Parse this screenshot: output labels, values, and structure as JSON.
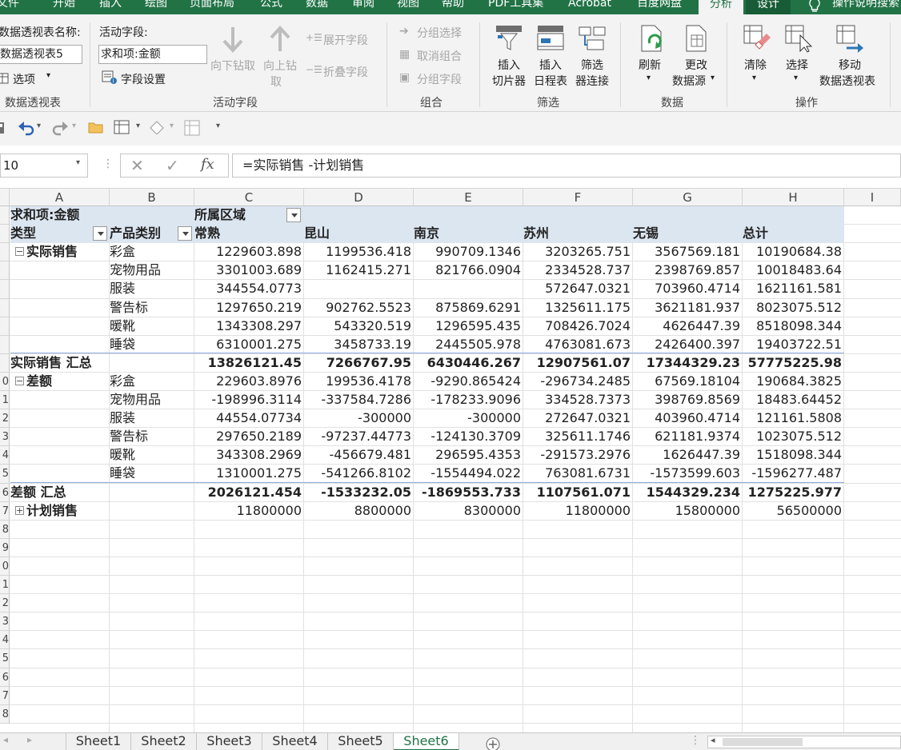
{
  "ribbon_tabs": [
    "文件",
    "开始",
    "插入",
    "绘图",
    "页面布局",
    "公式",
    "数据",
    "审阅",
    "视图",
    "帮助",
    "PDF工具集",
    "Acrobat",
    "百度网盘",
    "分析",
    "设计",
    "操作说明搜索"
  ],
  "pivot_group": {
    "name_label": "数据透视表名称:",
    "name_value": "数据透视表5",
    "options": "选项",
    "group_label": "数据透视表"
  },
  "active_field": {
    "label": "活动字段:",
    "value": "求和项:金额",
    "field_settings": "字段设置",
    "drill_down": "向下钻取",
    "drill_up_1": "向上钻",
    "drill_up_2": "取",
    "expand": "展开字段",
    "collapse": "折叠字段",
    "group_label": "活动字段"
  },
  "group": {
    "group_selection": "分组选择",
    "ungroup": "取消组合",
    "group_field": "分组字段",
    "group_label": "组合"
  },
  "filter": {
    "slicer_1": "插入",
    "slicer_2": "切片器",
    "timeline_1": "插入",
    "timeline_2": "日程表",
    "connections_1": "筛选",
    "connections_2": "器连接",
    "group_label": "筛选"
  },
  "data_group": {
    "refresh": "刷新",
    "change_1": "更改",
    "change_2": "数据源",
    "group_label": "数据"
  },
  "actions": {
    "clear": "清除",
    "select": "选择",
    "move_1": "移动",
    "move_2": "数据透视表",
    "group_label": "操作"
  },
  "formula_bar": {
    "name_box": "10",
    "fx": "fx",
    "formula": "=实际销售 -计划销售"
  },
  "columns": [
    "A",
    "B",
    "C",
    "D",
    "E",
    "F",
    "G",
    "H",
    "I"
  ],
  "row_numbers": [
    "",
    "",
    "",
    "",
    "",
    "",
    "",
    "",
    "",
    "0",
    "1",
    "2",
    "3",
    "4",
    "5",
    "6",
    "7",
    "8",
    "9",
    "0",
    "1",
    "2",
    "3",
    "4",
    "5",
    "6",
    "7",
    "8",
    "9"
  ],
  "pivot": {
    "value_label": "求和项:金额",
    "col_field": "所属区域",
    "row_field_1": "类型",
    "row_field_2": "产品类别",
    "regions": [
      "常熟",
      "昆山",
      "南京",
      "苏州",
      "无锡",
      "总计"
    ],
    "sections": [
      {
        "name": "实际销售",
        "toggle": "−",
        "rows": [
          {
            "cat": "彩盒",
            "v": [
              "1229603.898",
              "1199536.418",
              "990709.1346",
              "3203265.751",
              "3567569.181",
              "10190684.38"
            ]
          },
          {
            "cat": "宠物用品",
            "v": [
              "3301003.689",
              "1162415.271",
              "821766.0904",
              "2334528.737",
              "2398769.857",
              "10018483.64"
            ]
          },
          {
            "cat": "服装",
            "v": [
              "344554.0773",
              "",
              "",
              "572647.0321",
              "703960.4714",
              "1621161.581"
            ]
          },
          {
            "cat": "警告标",
            "v": [
              "1297650.219",
              "902762.5523",
              "875869.6291",
              "1325611.175",
              "3621181.937",
              "8023075.512"
            ]
          },
          {
            "cat": "暖靴",
            "v": [
              "1343308.297",
              "543320.519",
              "1296595.435",
              "708426.7024",
              "4626447.39",
              "8518098.344"
            ]
          },
          {
            "cat": "睡袋",
            "v": [
              "6310001.275",
              "3458733.19",
              "2445505.978",
              "4763081.673",
              "2426400.397",
              "19403722.51"
            ]
          }
        ],
        "total_label": "实际销售 汇总",
        "total": [
          "13826121.45",
          "7266767.95",
          "6430446.267",
          "12907561.07",
          "17344329.23",
          "57775225.98"
        ]
      },
      {
        "name": "差额",
        "toggle": "−",
        "rows": [
          {
            "cat": "彩盒",
            "v": [
              "229603.8976",
              "199536.4178",
              "-9290.865424",
              "-296734.2485",
              "67569.18104",
              "190684.3825"
            ]
          },
          {
            "cat": "宠物用品",
            "v": [
              "-198996.3114",
              "-337584.7286",
              "-178233.9096",
              "334528.7373",
              "398769.8569",
              "18483.64452"
            ]
          },
          {
            "cat": "服装",
            "v": [
              "44554.07734",
              "-300000",
              "-300000",
              "272647.0321",
              "403960.4714",
              "121161.5808"
            ]
          },
          {
            "cat": "警告标",
            "v": [
              "297650.2189",
              "-97237.44773",
              "-124130.3709",
              "325611.1746",
              "621181.9374",
              "1023075.512"
            ]
          },
          {
            "cat": "暖靴",
            "v": [
              "343308.2969",
              "-456679.481",
              "296595.4353",
              "-291573.2976",
              "1626447.39",
              "1518098.344"
            ]
          },
          {
            "cat": "睡袋",
            "v": [
              "1310001.275",
              "-541266.8102",
              "-1554494.022",
              "763081.6731",
              "-1573599.603",
              "-1596277.487"
            ]
          }
        ],
        "total_label": "差额 汇总",
        "total": [
          "2026121.454",
          "-1533232.05",
          "-1869553.733",
          "1107561.071",
          "1544329.234",
          "1275225.977"
        ]
      }
    ],
    "collapsed": {
      "name": "计划销售",
      "toggle": "+",
      "v": [
        "11800000",
        "8800000",
        "8300000",
        "11800000",
        "15800000",
        "56500000"
      ]
    }
  },
  "sheets": [
    "Sheet1",
    "Sheet2",
    "Sheet3",
    "Sheet4",
    "Sheet5",
    "Sheet6"
  ],
  "active_sheet": "Sheet6",
  "colors": {
    "excel_green": "#217346",
    "pivot_header": "#dce6f1"
  }
}
